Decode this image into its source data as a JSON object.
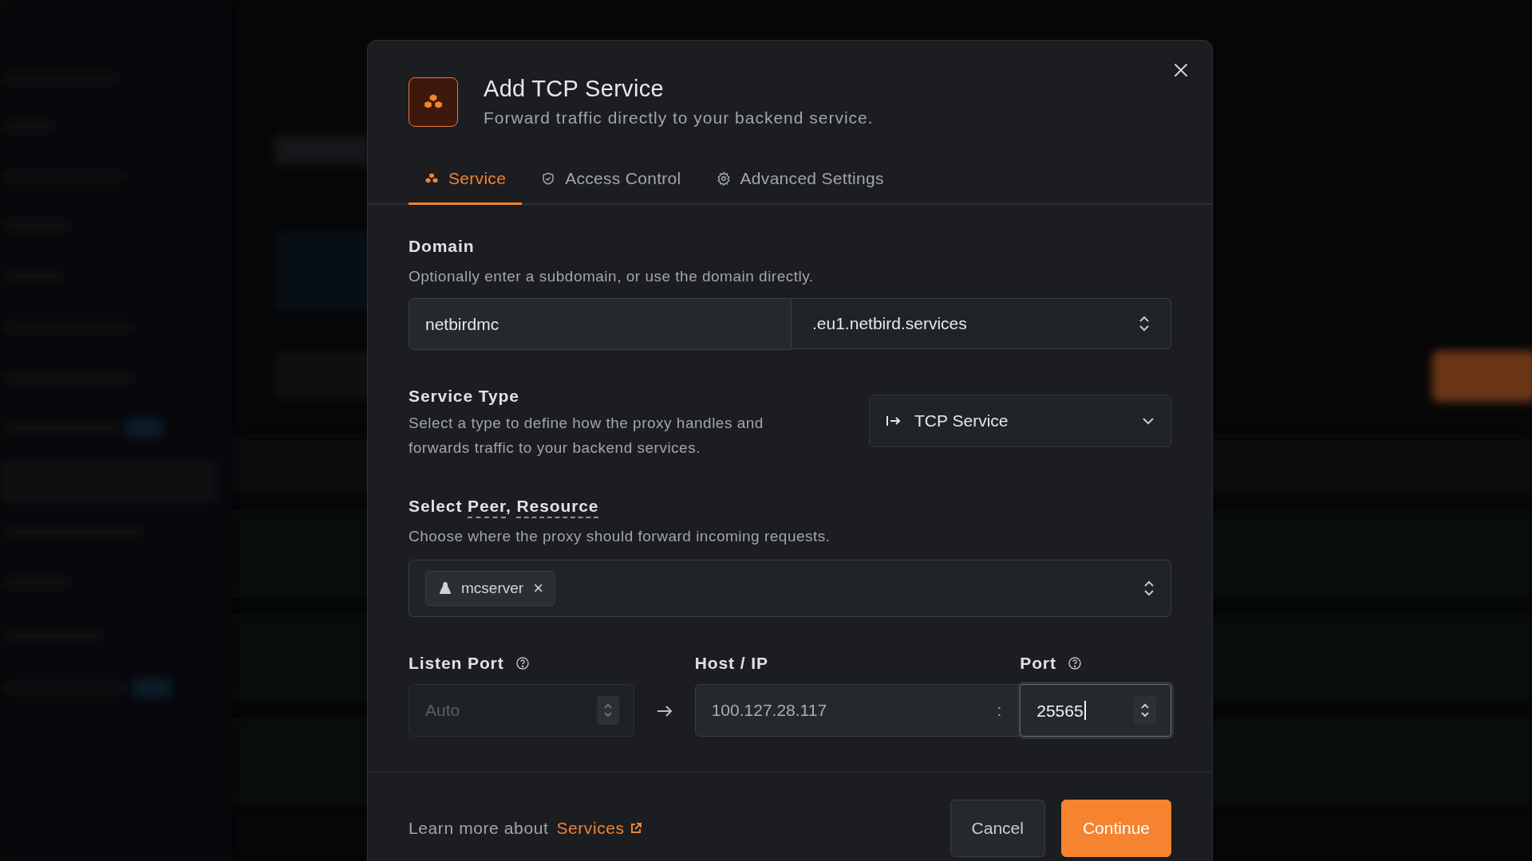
{
  "dialog": {
    "title": "Add TCP Service",
    "subtitle": "Forward traffic directly to your backend service.",
    "tabs": [
      {
        "label": "Service",
        "selected": true
      },
      {
        "label": "Access Control",
        "selected": false
      },
      {
        "label": "Advanced Settings",
        "selected": false
      }
    ],
    "domain": {
      "label": "Domain",
      "hint": "Optionally enter a subdomain, or use the domain directly.",
      "value": "netbirdmc",
      "suffix": ".eu1.netbird.services"
    },
    "service_type": {
      "label": "Service Type",
      "hint": "Select a type to define how the proxy handles and forwards traffic to your backend services.",
      "value": "TCP Service"
    },
    "target": {
      "label_parts": [
        {
          "text": "Select ",
          "term": false
        },
        {
          "text": "Peer",
          "term": true
        },
        {
          "text": ", ",
          "term": false
        },
        {
          "text": "Resource",
          "term": true
        }
      ],
      "hint": "Choose where the proxy should forward incoming requests.",
      "tags": [
        {
          "label": "mcserver",
          "remove": "×"
        }
      ]
    },
    "ports": {
      "listen": {
        "label": "Listen Port",
        "placeholder": "Auto"
      },
      "host": {
        "label": "Host / IP",
        "value": "100.127.28.117",
        "separator": ":"
      },
      "port": {
        "label": "Port",
        "value": "25565",
        "focused": true
      }
    },
    "footer": {
      "text": "Learn more about",
      "link": "Services",
      "buttons": [
        {
          "label": "Cancel",
          "kind": "secondary"
        },
        {
          "label": "Continue",
          "kind": "primary"
        }
      ]
    }
  }
}
